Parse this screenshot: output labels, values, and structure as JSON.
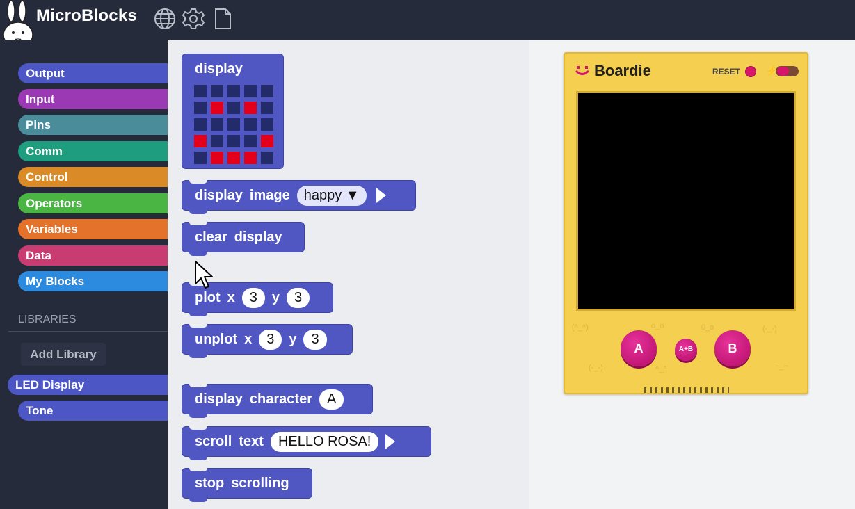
{
  "app": {
    "title": "MicroBlocks"
  },
  "topbar": {
    "icons": [
      "globe-icon",
      "gear-icon",
      "file-icon"
    ]
  },
  "sidebar": {
    "categories": [
      {
        "label": "Output",
        "color": "#4d56c5"
      },
      {
        "label": "Input",
        "color": "#9b38b3"
      },
      {
        "label": "Pins",
        "color": "#4a8c9a"
      },
      {
        "label": "Comm",
        "color": "#1e9e7e"
      },
      {
        "label": "Control",
        "color": "#db8a28"
      },
      {
        "label": "Operators",
        "color": "#4bb543"
      },
      {
        "label": "Variables",
        "color": "#e5722a"
      },
      {
        "label": "Data",
        "color": "#c93c72"
      },
      {
        "label": "My Blocks",
        "color": "#2d8bdf"
      }
    ],
    "libraries_label": "LIBRARIES",
    "add_library_label": "Add Library",
    "libraries": [
      {
        "label": "LED Display",
        "color": "#4d56c5",
        "selected": true
      },
      {
        "label": "Tone",
        "color": "#4d56c5",
        "selected": false
      }
    ]
  },
  "palette": {
    "display_block": {
      "label": "display",
      "grid": [
        [
          0,
          0,
          0,
          0,
          0
        ],
        [
          0,
          1,
          0,
          1,
          0
        ],
        [
          0,
          0,
          0,
          0,
          0
        ],
        [
          1,
          0,
          0,
          0,
          1
        ],
        [
          0,
          1,
          1,
          1,
          0
        ]
      ]
    },
    "display_image": {
      "words": [
        "display",
        "image"
      ],
      "value": "happy",
      "arrow": "▼"
    },
    "clear_display": {
      "words": [
        "clear",
        "display"
      ]
    },
    "plot": {
      "words": [
        "plot",
        "x",
        "y"
      ],
      "x": "3",
      "y": "3"
    },
    "unplot": {
      "words": [
        "unplot",
        "x",
        "y"
      ],
      "x": "3",
      "y": "3"
    },
    "display_character": {
      "words": [
        "display",
        "character"
      ],
      "value": "A"
    },
    "scroll_text": {
      "words": [
        "scroll",
        "text"
      ],
      "value": "HELLO ROSA!"
    },
    "stop_scrolling": {
      "words": [
        "stop",
        "scrolling"
      ]
    }
  },
  "simulator": {
    "board_name": "Boardie",
    "reset_label": "RESET",
    "button_a": "A",
    "button_ab": "A+B",
    "button_b": "B"
  }
}
